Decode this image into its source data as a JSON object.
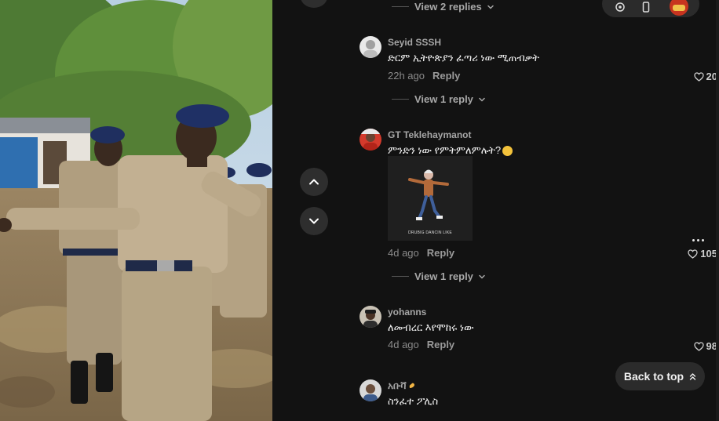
{
  "video": {
    "description_icon": "video-player"
  },
  "nav": {
    "up_icon": "chevron-up-icon",
    "down_icon": "chevron-down-icon"
  },
  "toolbar": {
    "icons": [
      "embed-icon",
      "device-icon",
      "avatar-icon"
    ]
  },
  "comments": [
    {
      "kind": "replies",
      "label": "View 2 replies"
    },
    {
      "kind": "comment",
      "name": "Seyid SSSH",
      "text": "ድርም ኢትዮጵያን ፈጣሪ ነው ሚጠብቃት",
      "time": "22h ago",
      "reply": "Reply",
      "likes": "20"
    },
    {
      "kind": "replies",
      "label": "View 1 reply"
    },
    {
      "kind": "comment",
      "name": "GT Teklehaymanot",
      "text": "ምንድን ነው የምትምለምሉት?",
      "time": "4d ago",
      "reply": "Reply",
      "likes": "105",
      "gif_caption": "DRUBIG DANCIN LIKE"
    },
    {
      "kind": "replies",
      "label": "View 1 reply"
    },
    {
      "kind": "comment",
      "name": "yohanns",
      "text": "ለመብረር እየሞከሩ ነው",
      "time": "4d ago",
      "reply": "Reply",
      "likes": "98"
    },
    {
      "kind": "comment",
      "name": "አቡቫ",
      "text": "ስንፈተ ፖሊስ"
    }
  ],
  "back_to_top": {
    "label": "Back to top"
  },
  "colors": {
    "background": "#121212",
    "button": "#2b2b2b",
    "muted_text": "#a6a6a6"
  }
}
